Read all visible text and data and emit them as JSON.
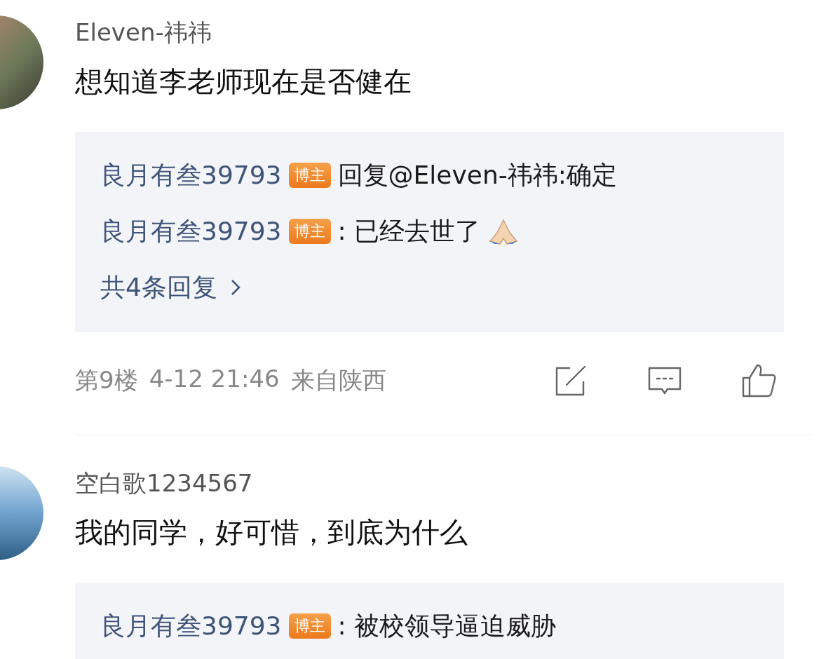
{
  "comments": [
    {
      "name": "Eleven-祎祎",
      "text": "想知道李老师现在是否健在",
      "replies": [
        {
          "author": "良月有叁39793",
          "badge": "博主",
          "text": "回复@Eleven-祎祎:确定",
          "praying_hands": false
        },
        {
          "author": "良月有叁39793",
          "badge": "博主",
          "text": ": 已经去世了",
          "praying_hands": true
        }
      ],
      "more_replies": "共4条回复",
      "meta": {
        "floor": "第9楼",
        "time": "4-12 21:46",
        "location": "来自陕西"
      }
    },
    {
      "name": "空白歌1234567",
      "text": "我的同学，好可惜，到底为什么",
      "replies": [
        {
          "author": "良月有叁39793",
          "badge": "博主",
          "text": ": 被校领导逼迫威胁",
          "praying_hands": false
        }
      ]
    }
  ]
}
